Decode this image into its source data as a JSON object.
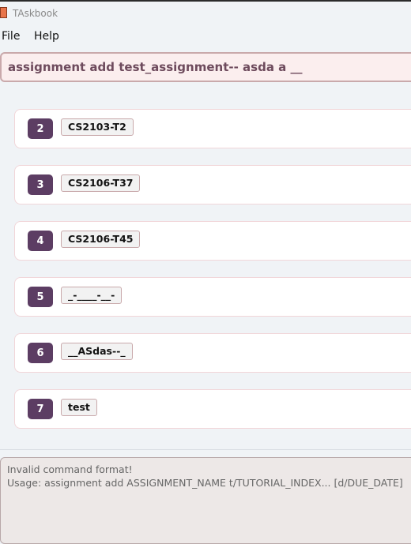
{
  "window": {
    "title": "TAskbook"
  },
  "menu": {
    "file": "File",
    "help": "Help"
  },
  "command_box": {
    "value": "assignment add test_assignment-- asda a __"
  },
  "tutorials": [
    {
      "index": "2",
      "name": "CS2103-T2"
    },
    {
      "index": "3",
      "name": "CS2106-T37"
    },
    {
      "index": "4",
      "name": "CS2106-T45"
    },
    {
      "index": "5",
      "name": "_-____-__-"
    },
    {
      "index": "6",
      "name": "__ASdas--_"
    },
    {
      "index": "7",
      "name": "test"
    }
  ],
  "result": {
    "line1": "Invalid command format!",
    "line2": "Usage: assignment add ASSIGNMENT_NAME t/TUTORIAL_INDEX... [d/DUE_DATE]"
  },
  "colors": {
    "badge": "#5c3d63",
    "command_text": "#6e4b5d",
    "tag_border": "#c9a9ab"
  }
}
